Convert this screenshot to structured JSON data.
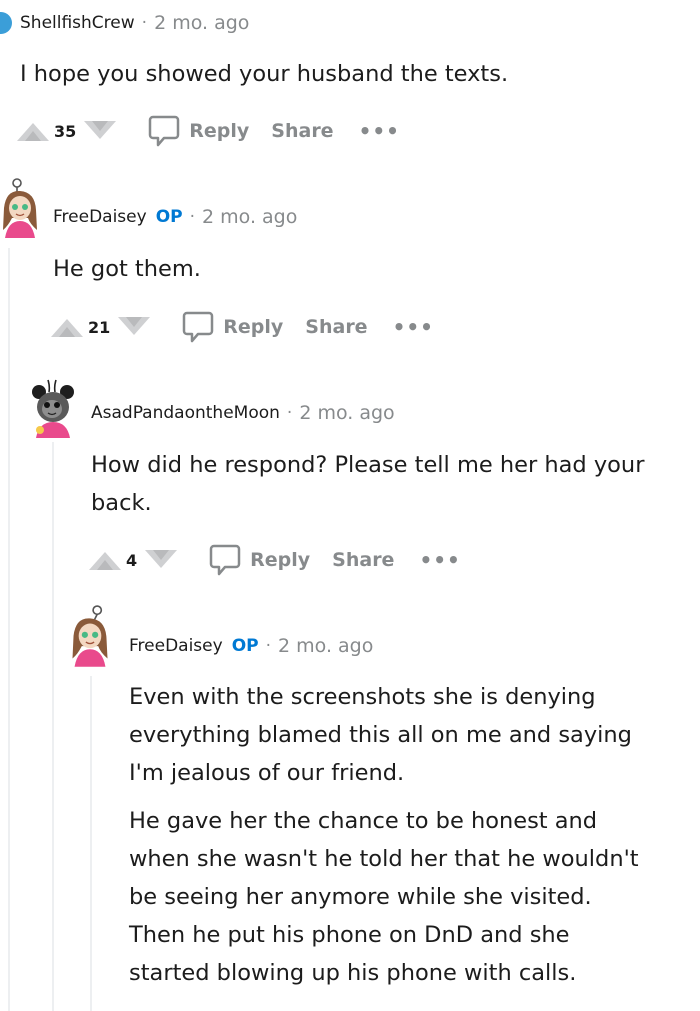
{
  "colors": {
    "op": "#0079d3",
    "meta": "#878a8c",
    "text": "#1c1c1c",
    "thread_line": "#edeff1",
    "avatar_pink": "#e94a8c"
  },
  "icons": {
    "upvote": "upvote-icon",
    "downvote": "downvote-icon",
    "reply": "comment-bubble-icon",
    "more": "more-options-icon"
  },
  "comments": [
    {
      "author": "ShellfishCrew",
      "op": "",
      "time": "2 mo. ago",
      "paragraphs": [
        "I hope you showed your husband the texts."
      ],
      "score": "35",
      "reply_label": "Reply",
      "share_label": "Share",
      "more_label": "•••"
    },
    {
      "author": "FreeDaisey",
      "op": "OP",
      "time": "2 mo. ago",
      "paragraphs": [
        "He got them."
      ],
      "score": "21",
      "reply_label": "Reply",
      "share_label": "Share",
      "more_label": "•••"
    },
    {
      "author": "AsadPandaontheMoon",
      "op": "",
      "time": "2 mo. ago",
      "paragraphs": [
        "How did he respond? Please tell me her had your back."
      ],
      "score": "4",
      "reply_label": "Reply",
      "share_label": "Share",
      "more_label": "•••"
    },
    {
      "author": "FreeDaisey",
      "op": "OP",
      "time": "2 mo. ago",
      "paragraphs": [
        "Even with the screenshots she is denying everything blamed this all on me and saying I'm jealous of our friend.",
        "He gave her the chance to be honest and when she wasn't he told her that he wouldn't be seeing her anymore while she visited. Then he put his phone on DnD and she started blowing up his phone with calls."
      ]
    }
  ]
}
